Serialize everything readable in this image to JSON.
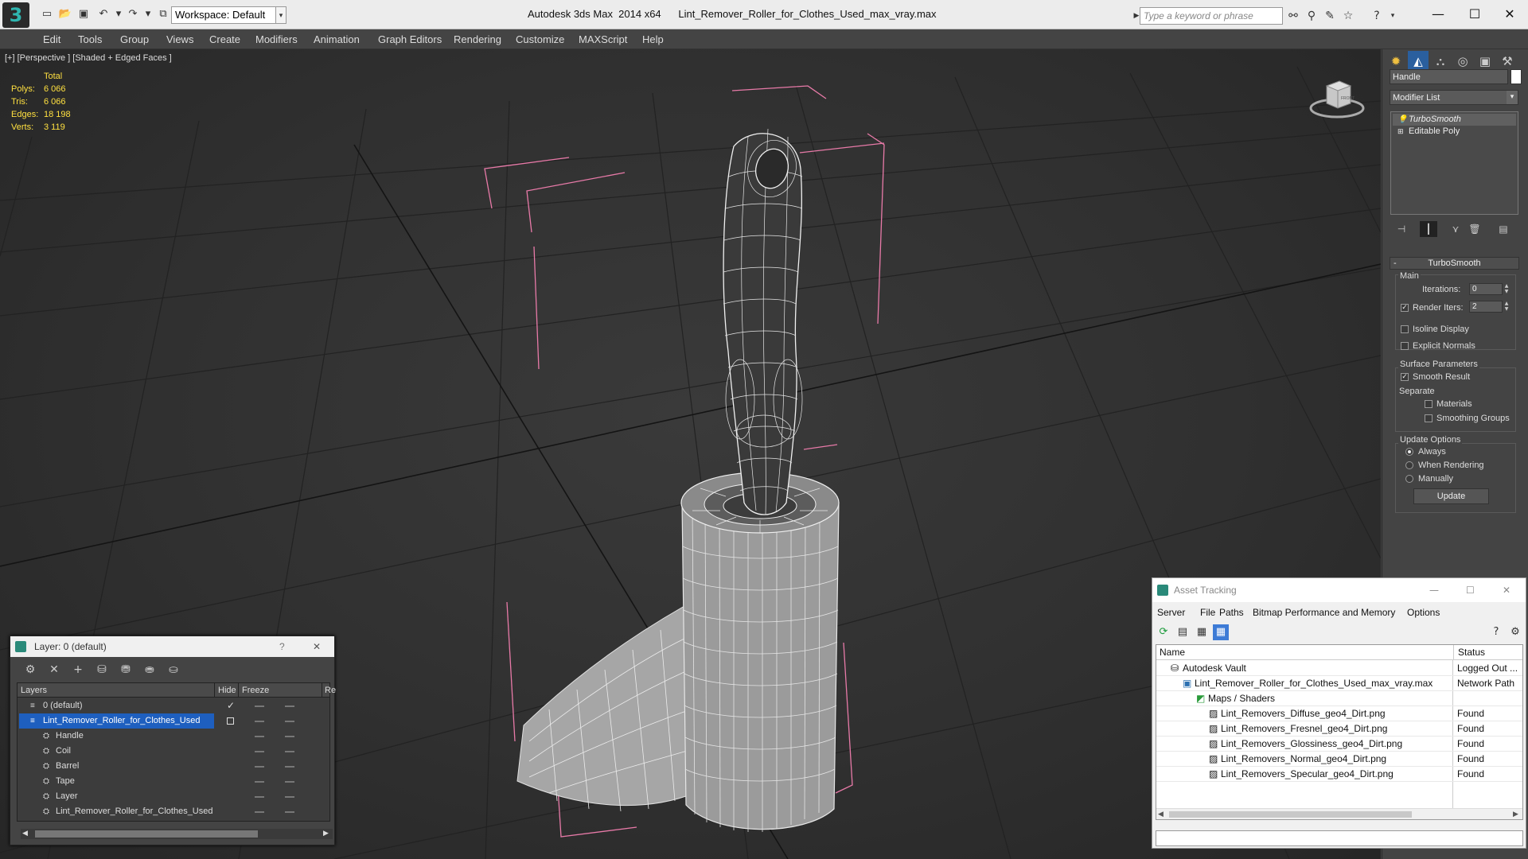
{
  "window": {
    "app_title": "Autodesk 3ds Max  2014 x64",
    "file_name": "Lint_Remover_Roller_for_Clothes_Used_max_vray.max",
    "logo_glyph": "3",
    "minimize": "—",
    "maximize": "☐",
    "close": "✕"
  },
  "toolbar": {
    "workspace_label": "Workspace: Default",
    "search_placeholder": "Type a keyword or phrase"
  },
  "menu": [
    "Edit",
    "Tools",
    "Group",
    "Views",
    "Create",
    "Modifiers",
    "Animation",
    "Graph Editors",
    "Rendering",
    "Customize",
    "MAXScript",
    "Help"
  ],
  "viewport": {
    "label": "[+] [Perspective ] [Shaded + Edged Faces ]",
    "stats_total": "Total",
    "stats": [
      {
        "key": "Polys:",
        "value": "6 066"
      },
      {
        "key": "Tris:",
        "value": "6 066"
      },
      {
        "key": "Edges:",
        "value": "18 198"
      },
      {
        "key": "Verts:",
        "value": "3 119"
      }
    ],
    "viewcube_face": "FRONT"
  },
  "command_panel": {
    "object_name": "Handle",
    "modifier_list": "Modifier List",
    "stack": [
      "TurboSmooth",
      "Editable Poly"
    ],
    "turbosmooth": {
      "title": "TurboSmooth",
      "main": "Main",
      "iterations_label": "Iterations:",
      "iterations": "0",
      "render_iters_label": "Render Iters:",
      "render_iters": "2",
      "isoline": "Isoline Display",
      "explicit_normals": "Explicit Normals",
      "surface_params": "Surface Parameters",
      "smooth_result": "Smooth Result",
      "separate": "Separate",
      "materials": "Materials",
      "smoothing_groups": "Smoothing Groups",
      "update_options": "Update Options",
      "always": "Always",
      "when_rendering": "When Rendering",
      "manually": "Manually",
      "update_button": "Update"
    }
  },
  "layer_window": {
    "title": "Layer: 0 (default)",
    "help": "?",
    "close": "✕",
    "col_layers": "Layers",
    "col_hide": "Hide",
    "col_freeze": "Freeze",
    "col_render": "Re",
    "rows": [
      {
        "name": "0 (default)",
        "indent": 0
      },
      {
        "name": "Lint_Remover_Roller_for_Clothes_Used",
        "indent": 0
      },
      {
        "name": "Handle",
        "indent": 1
      },
      {
        "name": "Coil",
        "indent": 1
      },
      {
        "name": "Barrel",
        "indent": 1
      },
      {
        "name": "Tape",
        "indent": 1
      },
      {
        "name": "Layer",
        "indent": 1
      },
      {
        "name": "Lint_Remover_Roller_for_Clothes_Used",
        "indent": 1
      }
    ]
  },
  "asset_window": {
    "title": "Asset Tracking",
    "menu": [
      "Server",
      "File",
      "Paths",
      "Bitmap Performance and Memory",
      "Options"
    ],
    "col_name": "Name",
    "col_status": "Status",
    "rows": [
      {
        "name": "Autodesk Vault",
        "status": "Logged Out ...",
        "indent": 1
      },
      {
        "name": "Lint_Remover_Roller_for_Clothes_Used_max_vray.max",
        "status": "Network Path",
        "indent": 2
      },
      {
        "name": "Maps / Shaders",
        "status": "",
        "indent": 3
      },
      {
        "name": "Lint_Removers_Diffuse_geo4_Dirt.png",
        "status": "Found",
        "indent": 4
      },
      {
        "name": "Lint_Removers_Fresnel_geo4_Dirt.png",
        "status": "Found",
        "indent": 4
      },
      {
        "name": "Lint_Removers_Glossiness_geo4_Dirt.png",
        "status": "Found",
        "indent": 4
      },
      {
        "name": "Lint_Removers_Normal_geo4_Dirt.png",
        "status": "Found",
        "indent": 4
      },
      {
        "name": "Lint_Removers_Specular_geo4_Dirt.png",
        "status": "Found",
        "indent": 4
      }
    ]
  }
}
